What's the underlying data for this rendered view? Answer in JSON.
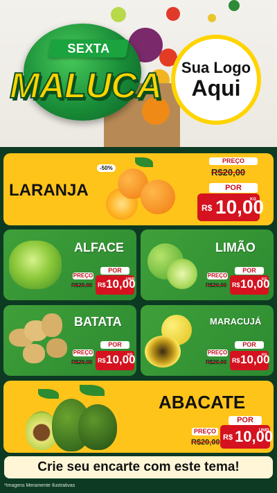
{
  "hero": {
    "badge_top": "SEXTA",
    "badge_main": "MALUCA",
    "logo_line1": "Sua Logo",
    "logo_line2": "Aqui"
  },
  "products": {
    "laranja": {
      "name": "LARANJA",
      "discount": "-50%",
      "preco_label": "PREÇO",
      "old_price": "R$20,00",
      "por_label": "POR",
      "currency": "R$",
      "price": "10,00",
      "unit": "KG"
    },
    "alface": {
      "name": "ALFACE",
      "preco_label": "PREÇO",
      "old_price": "R$20,00",
      "por_label": "POR",
      "currency": "R$",
      "price": "10,00",
      "unit": "UNID"
    },
    "limao": {
      "name": "LIMÃO",
      "preco_label": "PREÇO",
      "old_price": "R$20,00",
      "por_label": "POR",
      "currency": "R$",
      "price": "10,00",
      "unit": "KG"
    },
    "batata": {
      "name": "BATATA",
      "preco_label": "PREÇO",
      "old_price": "R$20,00",
      "por_label": "POR",
      "currency": "R$",
      "price": "10,00",
      "unit": "KG"
    },
    "maracuja": {
      "name": "MARACUJÁ",
      "preco_label": "PREÇO",
      "old_price": "R$20,00",
      "por_label": "POR",
      "currency": "R$",
      "price": "10,00",
      "unit": "KG"
    },
    "abacate": {
      "name": "ABACATE",
      "preco_label": "PREÇO",
      "old_price": "R$20,00",
      "por_label": "POR",
      "currency": "R$",
      "price": "10,00",
      "unit": "UNID"
    }
  },
  "tagline": "Crie seu encarte com este tema!",
  "footnote": "*Imagens Meramente Ilustrativas",
  "colors": {
    "yellow": "#ffc41a",
    "green": "#3fa03a",
    "red": "#d5121f",
    "dark": "#0d3a22"
  }
}
